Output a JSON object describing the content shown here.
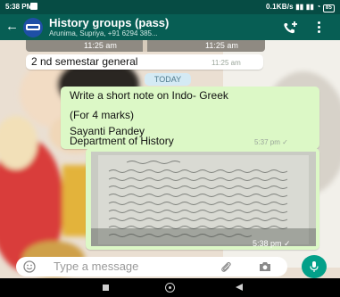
{
  "status_bar": {
    "time": "5:38 PM",
    "network": "0.1KB/s",
    "battery": "85"
  },
  "header": {
    "title": "History groups (pass)",
    "subtitle": "Arunima, Supriya, +91 6294 385...",
    "icons": [
      "back-arrow-icon",
      "group-avatar",
      "add-call-icon",
      "more-menu-icon"
    ]
  },
  "chat": {
    "media_times": [
      "11:25 am",
      "11:25 am"
    ],
    "message_1": {
      "text": "2 nd semestar general",
      "time": "11:25 am"
    },
    "date_chip": "TODAY",
    "message_2": {
      "line_1": "Write a short note on Indo- Greek",
      "line_2": "(For 4 marks)",
      "line_3": "Sayanti Pandey",
      "line_4": "Department of History",
      "time": "5:37 pm ✓"
    },
    "photo_time": "5:38 pm ✓"
  },
  "composer": {
    "placeholder": "Type a message"
  },
  "colors": {
    "header": "#075e54",
    "outgoing_bubble": "#dcf8c6",
    "mic_button": "#03a089"
  }
}
